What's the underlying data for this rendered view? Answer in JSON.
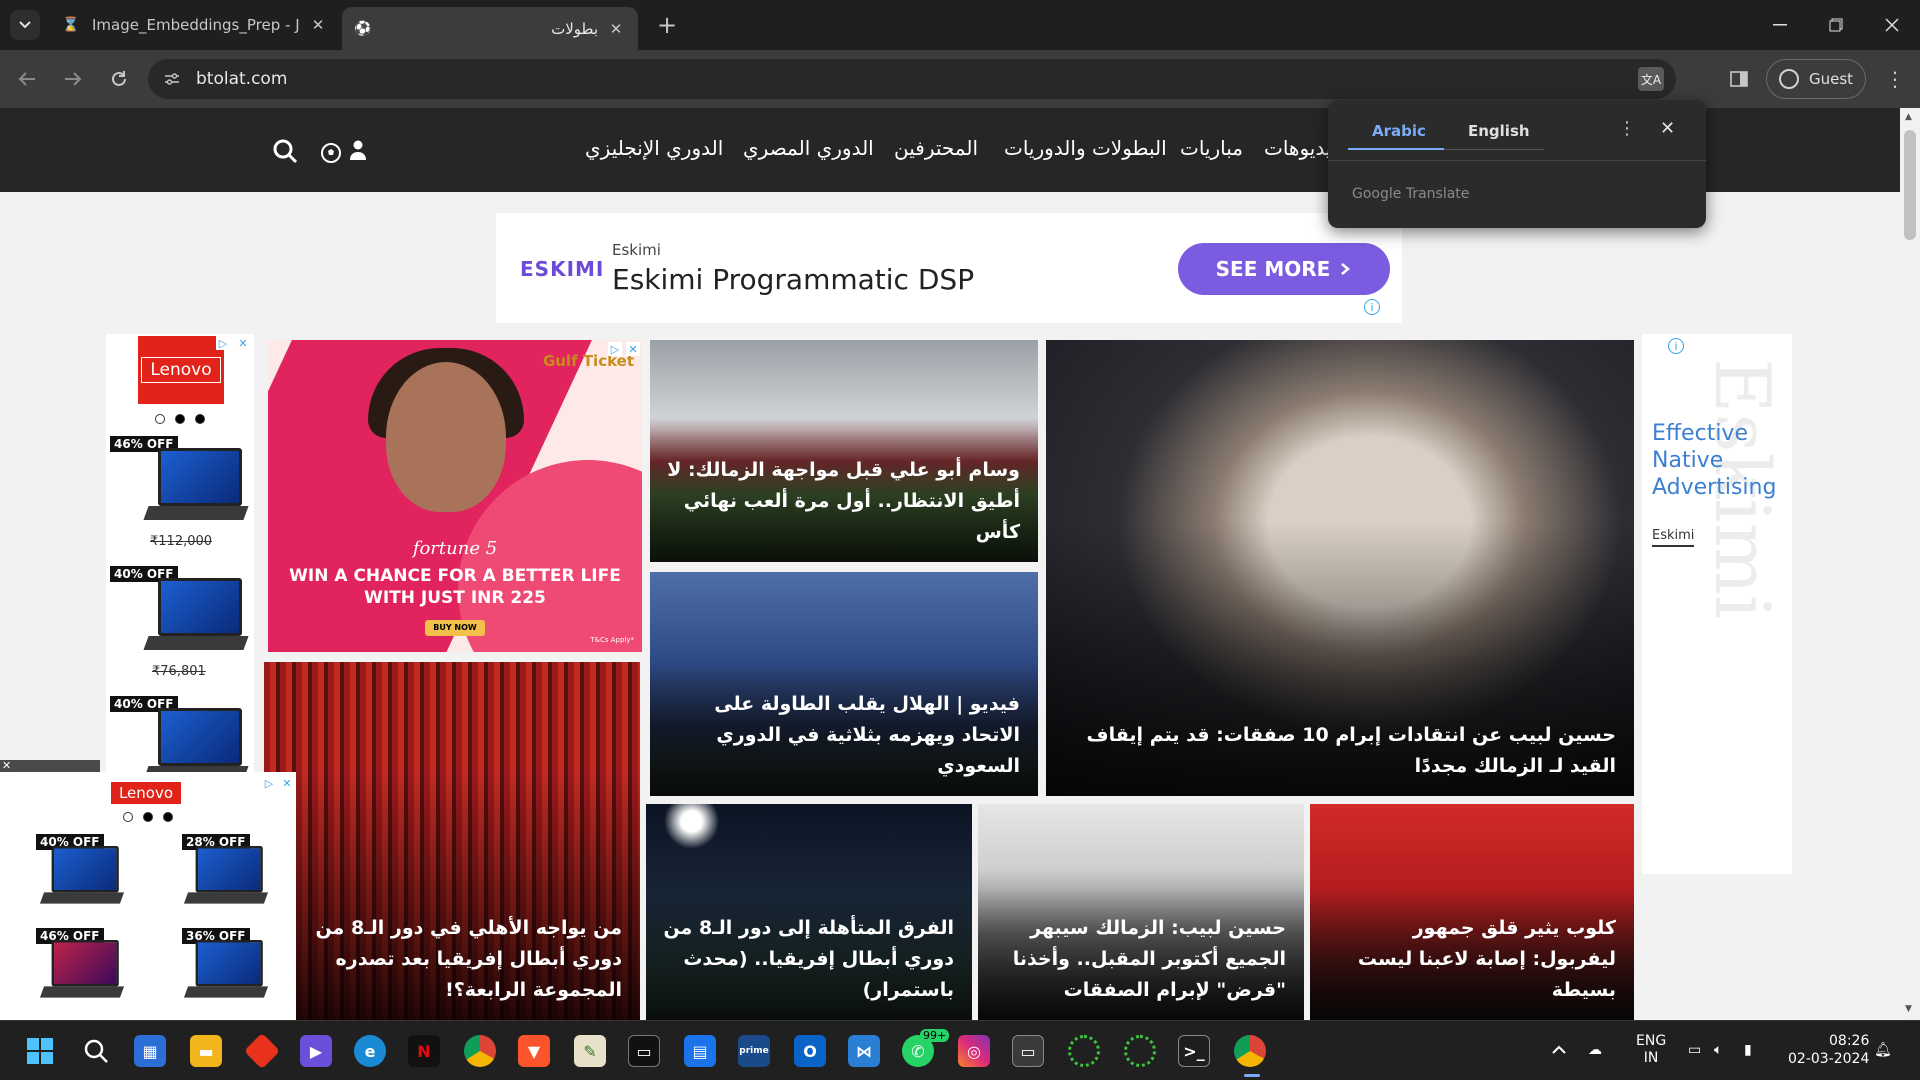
{
  "browser": {
    "tabs": [
      {
        "title": "Image_Embeddings_Prep - Jupyter",
        "active": false
      },
      {
        "title": "بطولات",
        "active": true
      }
    ],
    "url": "btolat.com",
    "profile_label": "Guest"
  },
  "site": {
    "nav": [
      "الدوري الإنجليزي",
      "الدوري المصري",
      "المحترفين",
      "البطولات والدوريات",
      "مباريات",
      "فيديوهات"
    ]
  },
  "translate_bubble": {
    "source": "Arabic",
    "target": "English",
    "provider": "Google Translate"
  },
  "ads": {
    "top": {
      "brand": "ESKIMI",
      "advertiser": "Eskimi",
      "headline": "Eskimi Programmatic DSP",
      "cta": "SEE MORE"
    },
    "left": {
      "brand": "Lenovo",
      "items": [
        {
          "discount": "46% OFF",
          "price": "₹112,000"
        },
        {
          "discount": "40% OFF",
          "price": "₹76,801"
        },
        {
          "discount": "40% OFF",
          "price": ""
        }
      ]
    },
    "promo": {
      "brand": "Gulf Ticket",
      "product": "fortune 5",
      "line1": "WIN A CHANCE FOR A BETTER LIFE",
      "line2": "WITH JUST INR 225",
      "cta": "BUY NOW",
      "terms": "T&Cs Apply*"
    },
    "right": {
      "title": "Effective Native Advertising",
      "label": "Eskimi",
      "watermark": "Eskimi"
    },
    "sticky": {
      "brand": "Lenovo",
      "badges": [
        "40% OFF",
        "28% OFF",
        "46% OFF",
        "36% OFF"
      ]
    }
  },
  "news": [
    {
      "headline": "حسين لبيب عن انتقادات إبرام 10 صفقات: قد يتم إيقاف القيد لـ الزمالك مجددًا"
    },
    {
      "headline": "وسام أبو علي قبل مواجهة الزمالك: لا أطيق الانتظار.. أول مرة ألعب نهائي كأس"
    },
    {
      "headline": "فيديو | الهلال يقلب الطاولة على الاتحاد ويهزمه بثلاثية في الدوري السعودي"
    },
    {
      "headline": "من يواجه الأهلي في دور الـ8 من دوري أبطال إفريقيا بعد تصدره المجموعة الرابعة؟!"
    },
    {
      "headline": "الفرق المتأهلة إلى دور الـ8 من دوري أبطال إفريقيا.. (محدث باستمرار)"
    },
    {
      "headline": "حسين لبيب: الزمالك سيبهر الجميع أكتوبر المقبل.. وأخذنا \"قرض\" لإبرام الصفقات"
    },
    {
      "headline": "كلوب يثير قلق جمهور ليفربول: إصابة لاعبنا ليست بسيطة"
    }
  ],
  "taskbar": {
    "language": "ENG",
    "region": "IN",
    "time": "08:26",
    "date": "02-03-2024",
    "whatsapp_badge": "99+"
  },
  "colors": {
    "accent": "#7cacf8",
    "site_nav": "#262626",
    "cta_purple": "#7b5ce0"
  }
}
